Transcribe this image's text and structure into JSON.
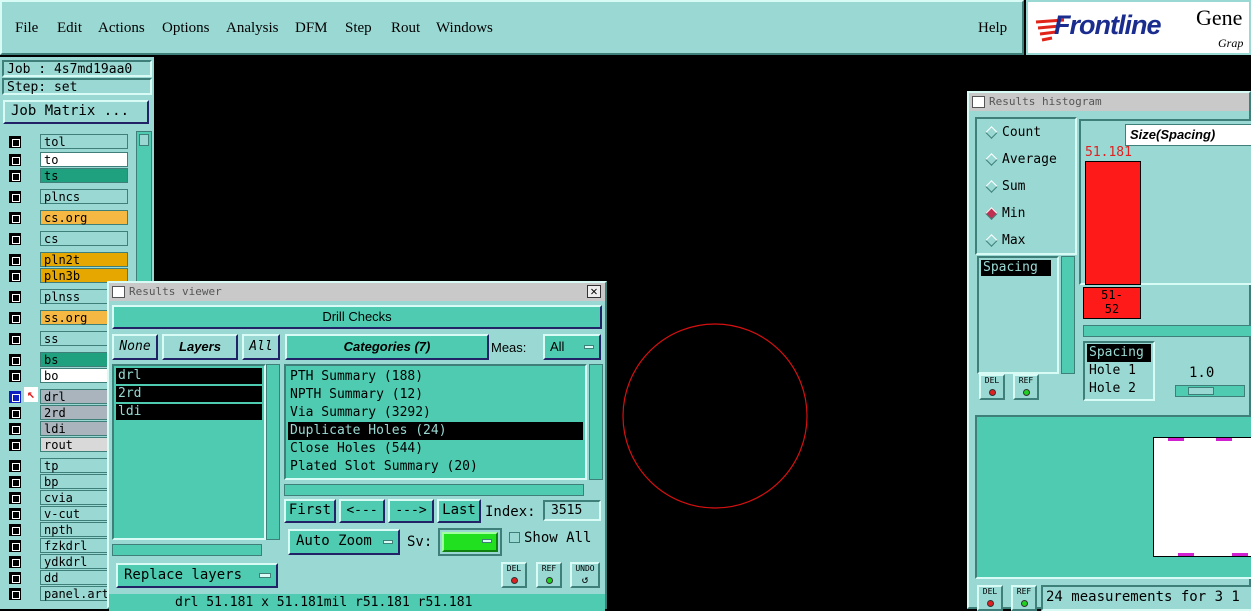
{
  "menubar": {
    "items": [
      "File",
      "Edit",
      "Actions",
      "Options",
      "Analysis",
      "DFM",
      "Step",
      "Rout",
      "Windows"
    ],
    "help": "Help"
  },
  "logo": {
    "brand": "Frontline",
    "line1": "Gene",
    "line2": "Grap"
  },
  "left": {
    "job": "Job : 4s7md19aa0",
    "step": "Step: set",
    "job_matrix": "Job Matrix ...",
    "layers": [
      {
        "name": "tol",
        "bg": "#9ad9d3"
      },
      {
        "name": "to",
        "bg": "#ffffff"
      },
      {
        "name": "ts",
        "bg": "#1fa07e"
      },
      {
        "name": "plncs",
        "bg": "#9ad9d3"
      },
      {
        "name": "cs.org",
        "bg": "#f5b842"
      },
      {
        "name": "cs",
        "bg": "#9ad9d3"
      },
      {
        "name": "pln2t",
        "bg": "#e6a800"
      },
      {
        "name": "pln3b",
        "bg": "#e6a800"
      },
      {
        "name": "plnss",
        "bg": "#9ad9d3"
      },
      {
        "name": "ss.org",
        "bg": "#f5b842"
      },
      {
        "name": "ss",
        "bg": "#9ad9d3"
      },
      {
        "name": "bs",
        "bg": "#1fa07e"
      },
      {
        "name": "bo",
        "bg": "#ffffff"
      },
      {
        "name": "drl",
        "bg": "#a9b4bc"
      },
      {
        "name": "2rd",
        "bg": "#a9b4bc"
      },
      {
        "name": "ldi",
        "bg": "#a9b4bc"
      },
      {
        "name": "rout",
        "bg": "#d9d9d9"
      },
      {
        "name": "tp",
        "bg": "#9ad9d3"
      },
      {
        "name": "bp",
        "bg": "#9ad9d3"
      },
      {
        "name": "cvia",
        "bg": "#9ad9d3"
      },
      {
        "name": "v-cut",
        "bg": "#9ad9d3"
      },
      {
        "name": "npth",
        "bg": "#9ad9d3"
      },
      {
        "name": "fzkdrl",
        "bg": "#9ad9d3"
      },
      {
        "name": "ydkdrl",
        "bg": "#9ad9d3"
      },
      {
        "name": "dd",
        "bg": "#9ad9d3"
      },
      {
        "name": "panel.art",
        "bg": "#9ad9d3"
      }
    ]
  },
  "viewer": {
    "title": "Results viewer",
    "heading": "Drill Checks",
    "none": "None",
    "layers_label": "Layers",
    "all": "All",
    "categories_label": "Categories (7)",
    "meas_label": "Meas:",
    "meas_value": "All",
    "layer_list": [
      "drl",
      "2rd",
      "ldi"
    ],
    "categories": [
      "PTH Summary (188)",
      "NPTH Summary (12)",
      "Via Summary (3292)",
      "Duplicate Holes (24)",
      "Close Holes (544)",
      "Plated Slot Summary (20)"
    ],
    "selected_category": 3,
    "first": "First",
    "prev": "<---",
    "next": "--->",
    "last": "Last",
    "index_label": "Index:",
    "index_value": "3515",
    "auto_zoom": "Auto Zoom",
    "sv_label": "Sv:",
    "show_all": "Show All",
    "replace_layers": "Replace layers",
    "del": "DEL",
    "ref": "REF",
    "undo": "UNDO",
    "status": "drl  51.181 x 51.181mil  r51.181  r51.181"
  },
  "histogram": {
    "title": "Results histogram",
    "modes": [
      "Count",
      "Average",
      "Sum",
      "Min",
      "Max"
    ],
    "selected_mode": 3,
    "size_label": "Size(Spacing)",
    "bar_value": "51.181",
    "bin_label": "51-\n52",
    "list1": [
      "Spacing"
    ],
    "list2": [
      "Spacing",
      "Hole 1",
      "Hole 2"
    ],
    "slider_value": "1.0",
    "del": "DEL",
    "ref": "REF",
    "footer": "24 measurements for 3 1"
  },
  "colors": {
    "panel": "#9ad9d3",
    "button": "#4ecbb0",
    "bar": "#ff1a1a",
    "circle": "#d41010",
    "sv_green": "#20e020"
  }
}
